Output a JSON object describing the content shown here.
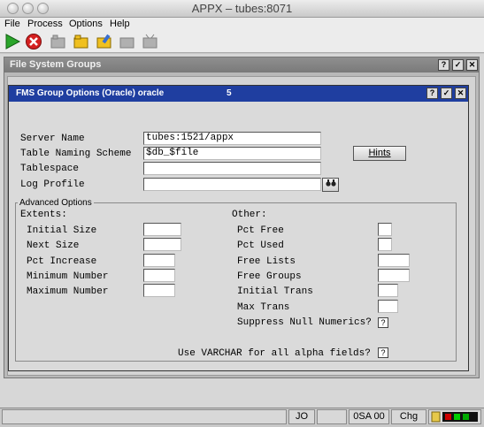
{
  "window": {
    "title": "APPX – tubes:8071"
  },
  "menu": {
    "file": "File",
    "process": "Process",
    "options": "Options",
    "help": "Help"
  },
  "fs_window": {
    "title": "File System Groups"
  },
  "dialog": {
    "title": "FMS Group Options  (Oracle)  oracle",
    "number": "5",
    "server_name_label": "Server Name",
    "server_name_value": "tubes:1521/appx",
    "table_naming_label": "Table Naming Scheme",
    "table_naming_value": "$db_$file",
    "tablespace_label": "Tablespace",
    "tablespace_value": "",
    "log_profile_label": "Log Profile",
    "log_profile_value": "",
    "hints_label": "Hints",
    "advanced_label": "Advanced Options",
    "extents_label": "Extents:",
    "other_label": "Other:",
    "extents": [
      "Initial Size",
      "Next Size",
      "Pct Increase",
      "Minimum Number",
      "Maximum Number"
    ],
    "other": [
      "Pct Free",
      "Pct Used",
      "Free Lists",
      "Free Groups",
      "Initial Trans",
      "Max Trans"
    ],
    "suppress_label": "Suppress Null Numerics?",
    "suppress_value": "?",
    "varchar_label": "Use VARCHAR for all alpha fields?",
    "varchar_value": "?"
  },
  "status": {
    "user": "JO",
    "app": "0SA 00",
    "mode": "Chg"
  }
}
